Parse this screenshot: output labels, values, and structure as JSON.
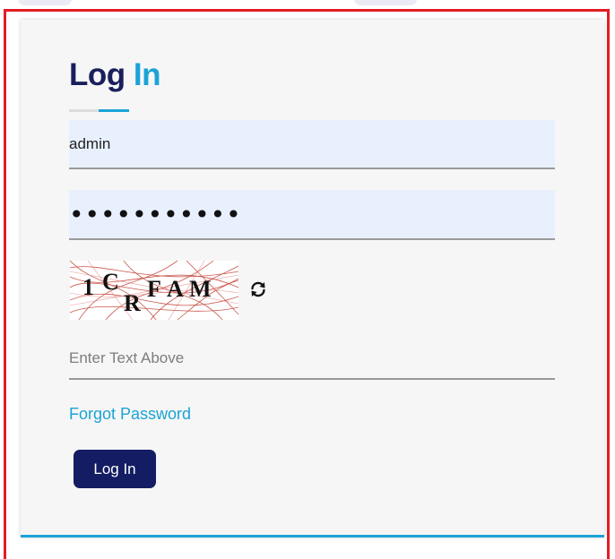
{
  "login": {
    "title_main": "Log",
    "title_accent": "In",
    "username_value": "admin",
    "password_value": "•••••••••••",
    "captcha_image_text": "1CRFAM",
    "captcha_input_placeholder": "Enter Text Above",
    "forgot_password_label": "Forgot Password",
    "submit_label": "Log In",
    "refresh_icon": "refresh-icon"
  },
  "colors": {
    "frame_red": "#e31c24",
    "title_navy": "#1a1f5c",
    "accent_blue": "#1ba3d6",
    "button_navy": "#141d63",
    "filled_field_bg": "#e8f0fe",
    "card_bg": "#f6f6f6"
  }
}
